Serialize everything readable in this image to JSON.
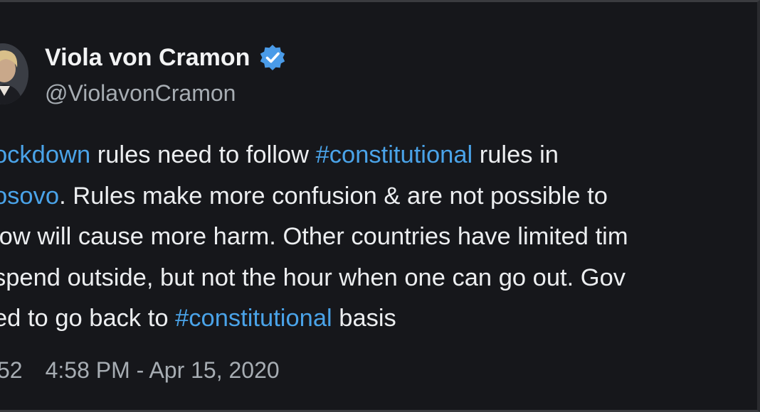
{
  "author": {
    "display_name": "Viola von Cramon",
    "handle": "@ViolavonCramon",
    "verified": true,
    "verified_color": "#4a9be8"
  },
  "tweet": {
    "lines": [
      [
        {
          "text": "ockdown",
          "hashtag": true
        },
        {
          "text": " rules need to follow ",
          "hashtag": false
        },
        {
          "text": "#constitutional",
          "hashtag": true
        },
        {
          "text": " rules in",
          "hashtag": false
        }
      ],
      [
        {
          "text": "osovo",
          "hashtag": true
        },
        {
          "text": ". Rules make more confusion & are not possible to",
          "hashtag": false
        }
      ],
      [
        {
          "text": "low will cause more harm. Other countries have limited tim",
          "hashtag": false
        }
      ],
      [
        {
          "text": "spend outside, but not the hour when one can go out. Gov",
          "hashtag": false
        }
      ],
      [
        {
          "text": "ed to go back to ",
          "hashtag": false
        },
        {
          "text": "#constitutional",
          "hashtag": true
        },
        {
          "text": " basis",
          "hashtag": false
        }
      ]
    ],
    "hashtag_color": "#4aa3e8"
  },
  "meta": {
    "count_fragment": "52",
    "timestamp": "4:58 PM - Apr 15, 2020"
  }
}
